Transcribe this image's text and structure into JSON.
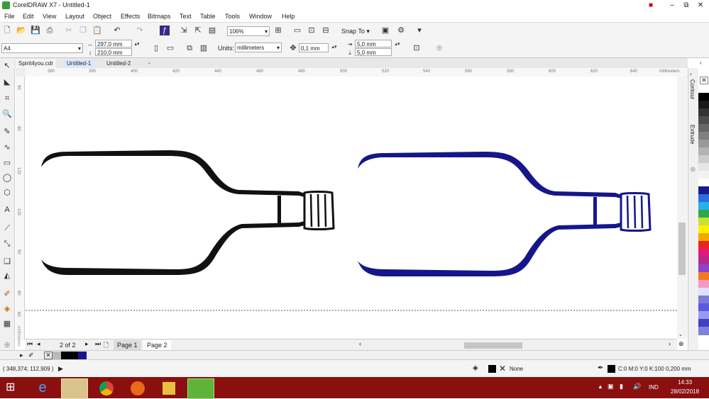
{
  "window": {
    "title": "CorelDRAW X7 - Untitled-1",
    "min": "–",
    "max": "⧉",
    "close": "✕"
  },
  "menu": [
    "File",
    "Edit",
    "View",
    "Layout",
    "Object",
    "Effects",
    "Bitmaps",
    "Text",
    "Table",
    "Tools",
    "Window",
    "Help"
  ],
  "toolbar": {
    "zoom": "106%",
    "snap": "Snap To"
  },
  "propbar": {
    "page_size": "A4",
    "width": "297,0 mm",
    "height": "210,0 mm",
    "units_label": "Units:",
    "units": "millimeters",
    "nudge": "0,1 mm",
    "dup_x": "5,0 mm",
    "dup_y": "5,0 mm"
  },
  "doc_tabs": [
    "Spirit4you.cdr",
    "Untitled-1",
    "Untitled-2"
  ],
  "ruler": {
    "h_ticks": [
      "380",
      "390",
      "400",
      "420",
      "440",
      "460",
      "480",
      "500",
      "520",
      "540",
      "560",
      "580",
      "600",
      "620",
      "640"
    ],
    "h_unit": "millimeters",
    "v_ticks": [
      "90",
      "80",
      "120",
      "100",
      "90",
      "80",
      "60"
    ],
    "v_unit": "millimeters"
  },
  "dock_tabs": [
    "Contour",
    "Extrude"
  ],
  "pages": {
    "counter": "2 of 2",
    "tabs": [
      "Page 1",
      "Page 2"
    ]
  },
  "status": {
    "coords": "( 348,374; 112,909 )",
    "fill": "None",
    "outline": "C:0 M:0 Y:0 K:100  0,200 mm"
  },
  "taskbar": {
    "lang": "IND",
    "time": "14:33",
    "date": "28/02/2018"
  },
  "colors": {
    "black_bottle": "#111111",
    "blue_bottle": "#16168a",
    "palette": [
      "#ffffff",
      "#000000",
      "#1a1a1a",
      "#333333",
      "#4d4d4d",
      "#666666",
      "#808080",
      "#999999",
      "#b3b3b3",
      "#cccccc",
      "#e6e6e6",
      "#f2f2f2",
      "#ffffff",
      "#1a1a8c",
      "#2a6fdb",
      "#27b0e6",
      "#2ea84a",
      "#c8e234",
      "#ffef00",
      "#f2a900",
      "#e8251e",
      "#e0197d",
      "#b4288c",
      "#8e44c8",
      "#f27a1d",
      "#f49ac2",
      "#e0e0ff",
      "#7b7bd9",
      "#5a5ae0",
      "#9a9af5",
      "#4040c0",
      "#8080e0"
    ]
  }
}
